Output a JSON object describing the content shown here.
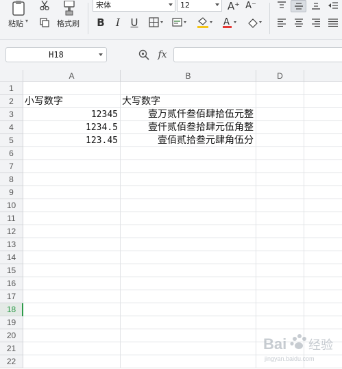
{
  "toolbar": {
    "paste_label": "粘贴",
    "format_painter_label": "格式刷",
    "font_name": "宋体",
    "font_size": "12",
    "grow_font_label": "A⁺",
    "shrink_font_label": "A⁻",
    "bold_label": "B",
    "italic_label": "I",
    "underline_label": "U",
    "font_color_label": "A",
    "accent_color": "#e53935",
    "highlight_color": "#f5c518"
  },
  "formula_bar": {
    "name_box": "H18",
    "fx_label": "fx",
    "formula_value": ""
  },
  "grid": {
    "columns": [
      "A",
      "B",
      "D"
    ],
    "rows": [
      "1",
      "2",
      "3",
      "4",
      "5",
      "6",
      "7",
      "8",
      "9",
      "10",
      "11",
      "12",
      "13",
      "14",
      "15",
      "16",
      "17",
      "18",
      "19",
      "20",
      "21",
      "22"
    ],
    "active_row": "18",
    "cells": {
      "A2": "小写数字",
      "B2": "大写数字",
      "A3": "12345",
      "B3": "壹万贰仟叁佰肆拾伍元整",
      "A4": "1234.5",
      "B4": "壹仟贰佰叁拾肆元伍角整",
      "A5": "123.45",
      "B5": "壹佰贰拾叁元肆角伍分"
    }
  },
  "watermark": {
    "text_cn": "Bai",
    "text_sub": "经验",
    "url": "jingyan.baidu.com"
  }
}
